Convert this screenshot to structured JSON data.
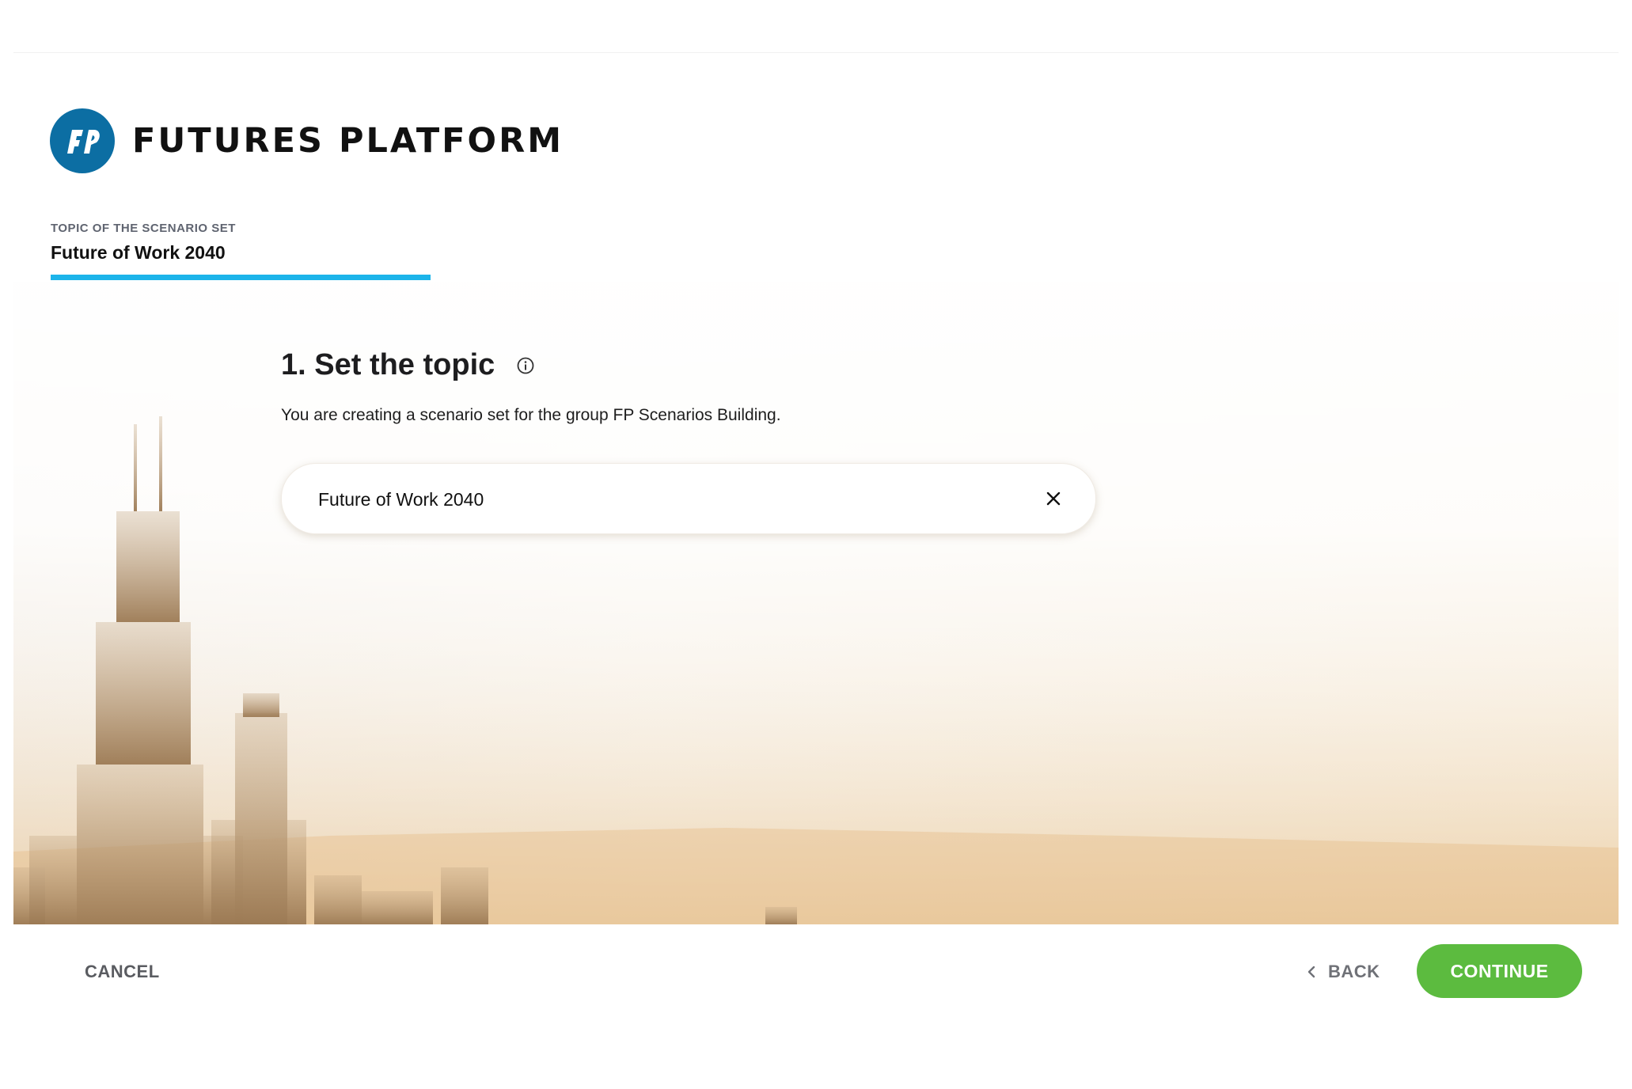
{
  "brand": {
    "name": "FUTURES PLATFORM",
    "logo_icon": "fp-logo-icon",
    "color": "#0c6ea3"
  },
  "tabs": [
    {
      "caption": "TOPIC OF THE SCENARIO SET",
      "value": "Future of Work 2040",
      "active": true,
      "accent": "#1cb4ea"
    }
  ],
  "step": {
    "heading": "1. Set the topic",
    "info_icon": "info-icon",
    "subtitle": "You are creating a scenario set for the group FP Scenarios Building."
  },
  "topic_input": {
    "value": "Future of Work 2040",
    "placeholder": "",
    "clear_icon": "close-icon"
  },
  "footer": {
    "cancel_label": "CANCEL",
    "back_label": "BACK",
    "continue_label": "CONTINUE",
    "continue_color": "#5cbb3f"
  }
}
